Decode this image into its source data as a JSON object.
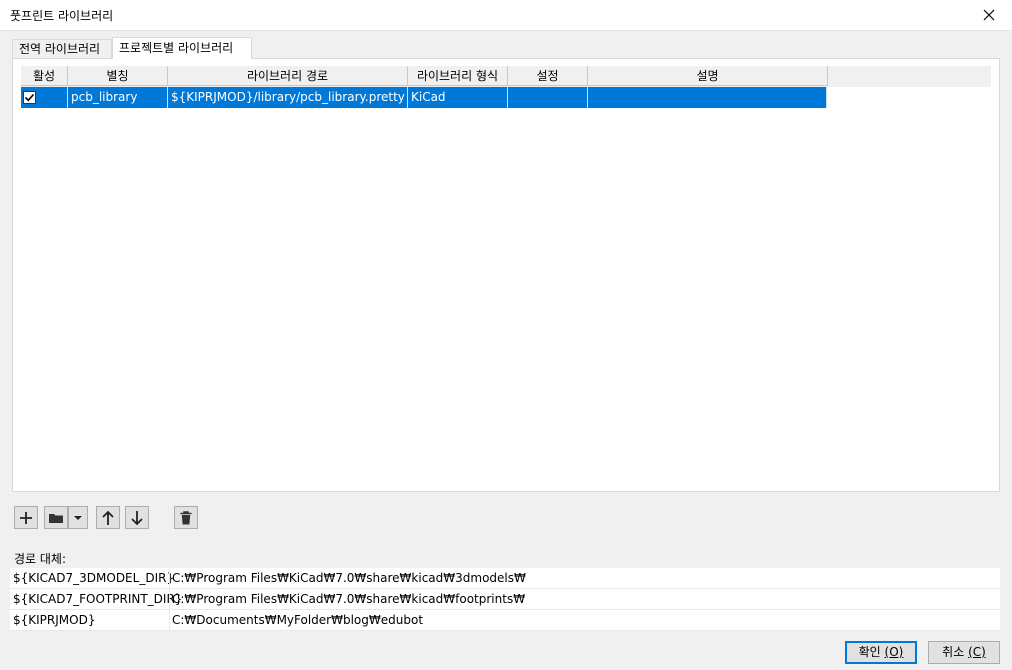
{
  "window": {
    "title": "풋프린트 라이브러리"
  },
  "tabs": [
    {
      "label": "전역 라이브러리"
    },
    {
      "label": "프로젝트별 라이브러리"
    }
  ],
  "table": {
    "headers": [
      "활성",
      "별칭",
      "라이브러리 경로",
      "라이브러리 형식",
      "설정",
      "설명"
    ],
    "rows": [
      {
        "enabled": true,
        "nickname": "pcb_library",
        "path": "${KIPRJMOD}/library/pcb_library.pretty",
        "type": "KiCad",
        "options": "",
        "description": ""
      }
    ]
  },
  "toolbar": {
    "icons": [
      "plus-icon",
      "folder-icon",
      "dropdown-arrow-icon",
      "arrow-up-icon",
      "arrow-down-icon",
      "trash-icon"
    ]
  },
  "path_substitutions": {
    "label": "경로 대체:",
    "rows": [
      {
        "name": "${KICAD7_3DMODEL_DIR}",
        "path": "C:₩Program Files₩KiCad₩7.0₩share₩kicad₩3dmodels₩"
      },
      {
        "name": "${KICAD7_FOOTPRINT_DIR}",
        "path": "C:₩Program Files₩KiCad₩7.0₩share₩kicad₩footprints₩"
      },
      {
        "name": "${KIPRJMOD}",
        "path": "C:₩Documents₩MyFolder₩blog₩edubot"
      }
    ]
  },
  "buttons": {
    "ok_label": "확인",
    "ok_mnemonic": "(O)",
    "cancel_label": "취소",
    "cancel_mnemonic": "(C)"
  },
  "colors": {
    "selection": "#0078d7",
    "background": "#f0f0f0"
  }
}
